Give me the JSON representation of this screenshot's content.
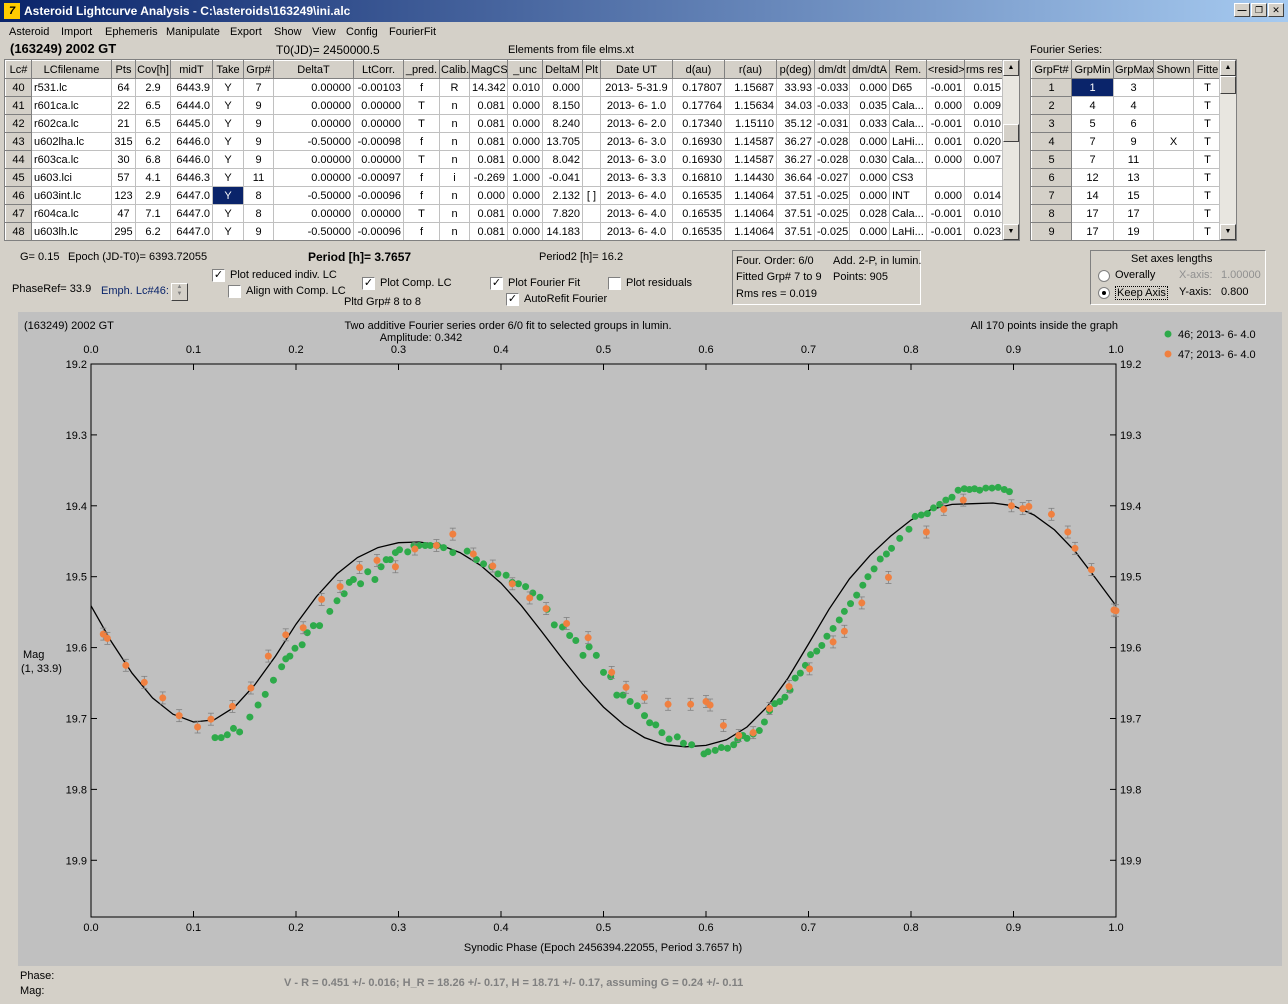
{
  "window": {
    "title": "Asteroid Lightcurve Analysis - C:\\asteroids\\163249\\ini.alc",
    "icon_label": "7"
  },
  "menu": [
    "Asteroid",
    "Import",
    "Ephemeris",
    "Manipulate",
    "Export",
    "Show",
    "View",
    "Config",
    "FourierFit"
  ],
  "asteroid_name": "(163249) 2002 GT",
  "t0": "T0(JD)= 2450000.5",
  "elements_note": "Elements from file elms.xt",
  "fourier_series_label": "Fourier Series:",
  "lc_table": {
    "headers": [
      "Lc#",
      "LCfilename",
      "Pts",
      "Cov[h]",
      "midT",
      "Take",
      "Grp#",
      "DeltaT",
      "LtCorr.",
      "_pred.",
      "Calib.",
      "MagCS",
      "_unc",
      "DeltaM",
      "Plt",
      "Date UT",
      "d(au)",
      "r(au)",
      "p(deg)",
      "dm/dt",
      "dm/dtA",
      "Rem.",
      "<resid>",
      "rms res"
    ],
    "rows": [
      [
        "40",
        "r531.lc",
        "64",
        "2.9",
        "6443.9",
        "Y",
        "7",
        "0.00000",
        "-0.00103",
        "f",
        "R",
        "14.342",
        "0.010",
        "0.000",
        "",
        "2013- 5-31.9",
        "0.17807",
        "1.15687",
        "33.93",
        "-0.033",
        "0.000",
        "D65",
        "-0.001",
        "0.015"
      ],
      [
        "41",
        "r601ca.lc",
        "22",
        "6.5",
        "6444.0",
        "Y",
        "9",
        "0.00000",
        "0.00000",
        "T",
        "n",
        "0.081",
        "0.000",
        "8.150",
        "",
        "2013- 6- 1.0",
        "0.17764",
        "1.15634",
        "34.03",
        "-0.033",
        "0.035",
        "Cala...",
        "0.000",
        "0.009"
      ],
      [
        "42",
        "r602ca.lc",
        "21",
        "6.5",
        "6445.0",
        "Y",
        "9",
        "0.00000",
        "0.00000",
        "T",
        "n",
        "0.081",
        "0.000",
        "8.240",
        "",
        "2013- 6- 2.0",
        "0.17340",
        "1.15110",
        "35.12",
        "-0.031",
        "0.033",
        "Cala...",
        "-0.001",
        "0.010"
      ],
      [
        "43",
        "u602lha.lc",
        "315",
        "6.2",
        "6446.0",
        "Y",
        "9",
        "-0.50000",
        "-0.00098",
        "f",
        "n",
        "0.081",
        "0.000",
        "13.705",
        "",
        "2013- 6- 3.0",
        "0.16930",
        "1.14587",
        "36.27",
        "-0.028",
        "0.000",
        "LaHi...",
        "0.001",
        "0.020"
      ],
      [
        "44",
        "r603ca.lc",
        "30",
        "6.8",
        "6446.0",
        "Y",
        "9",
        "0.00000",
        "0.00000",
        "T",
        "n",
        "0.081",
        "0.000",
        "8.042",
        "",
        "2013- 6- 3.0",
        "0.16930",
        "1.14587",
        "36.27",
        "-0.028",
        "0.030",
        "Cala...",
        "0.000",
        "0.007"
      ],
      [
        "45",
        "u603.lci",
        "57",
        "4.1",
        "6446.3",
        "Y",
        "11",
        "0.00000",
        "-0.00097",
        "f",
        "i",
        "-0.269",
        "1.000",
        "-0.041",
        "",
        "2013- 6- 3.3",
        "0.16810",
        "1.14430",
        "36.64",
        "-0.027",
        "0.000",
        "CS3",
        "",
        ""
      ],
      [
        "46",
        "u603int.lc",
        "123",
        "2.9",
        "6447.0",
        "Y",
        "8",
        "-0.50000",
        "-0.00096",
        "f",
        "n",
        "0.000",
        "0.000",
        "2.132",
        "[ ]",
        "2013- 6- 4.0",
        "0.16535",
        "1.14064",
        "37.51",
        "-0.025",
        "0.000",
        "INT",
        "0.000",
        "0.014"
      ],
      [
        "47",
        "r604ca.lc",
        "47",
        "7.1",
        "6447.0",
        "Y",
        "8",
        "0.00000",
        "0.00000",
        "T",
        "n",
        "0.081",
        "0.000",
        "7.820",
        "",
        "2013- 6- 4.0",
        "0.16535",
        "1.14064",
        "37.51",
        "-0.025",
        "0.028",
        "Cala...",
        "-0.001",
        "0.010"
      ],
      [
        "48",
        "u603lh.lc",
        "295",
        "6.2",
        "6447.0",
        "Y",
        "9",
        "-0.50000",
        "-0.00096",
        "f",
        "n",
        "0.081",
        "0.000",
        "14.183",
        "",
        "2013- 6- 4.0",
        "0.16535",
        "1.14064",
        "37.51",
        "-0.025",
        "0.000",
        "LaHi...",
        "-0.001",
        "0.023"
      ]
    ]
  },
  "fourier_table": {
    "headers": [
      "GrpFt#",
      "GrpMin",
      "GrpMax",
      "Shown",
      "Fitte"
    ],
    "rows": [
      [
        "1",
        "1",
        "3",
        "",
        "T"
      ],
      [
        "2",
        "4",
        "4",
        "",
        "T"
      ],
      [
        "3",
        "5",
        "6",
        "",
        "T"
      ],
      [
        "4",
        "7",
        "9",
        "X",
        "T"
      ],
      [
        "5",
        "7",
        "11",
        "",
        "T"
      ],
      [
        "6",
        "12",
        "13",
        "",
        "T"
      ],
      [
        "7",
        "14",
        "15",
        "",
        "T"
      ],
      [
        "8",
        "17",
        "17",
        "",
        "T"
      ],
      [
        "9",
        "17",
        "19",
        "",
        "T"
      ]
    ]
  },
  "controls": {
    "g": "G= 0.15",
    "epoch": "Epoch (JD-T0)= 6393.72055",
    "period": "Period [h]= 3.7657",
    "period2": "Period2 [h]= 16.2",
    "phaseref": "PhaseRef= 33.9",
    "emph": "Emph. Lc#46:",
    "plot_reduced": "Plot reduced indiv. LC",
    "align_comp": "Align with Comp. LC",
    "plot_comp": "Plot Comp. LC",
    "pltd_grp": "Pltd Grp#  8  to  8",
    "plot_fourier": "Plot Fourier Fit",
    "autorefit": "AutoRefit Fourier",
    "plot_residuals": "Plot residuals",
    "check": "✓"
  },
  "fit_info": {
    "four_order": "Four. Order:  6/0",
    "add": "Add. 2-P, in lumin.",
    "fitted": "Fitted Grp# 7 to 9",
    "points": "Points: 905",
    "rms": "Rms res     = 0.019"
  },
  "axes_box": {
    "title": "Set axes lengths",
    "overall": "Overally",
    "keep": "Keep Axis",
    "xaxis_label": "X-axis:",
    "xaxis_val": "1.00000",
    "yaxis_label": "Y-axis:",
    "yaxis_val": "0.800"
  },
  "footer": {
    "phase": "Phase:",
    "mag": "Mag:",
    "result": "V - R = 0.451 +/- 0.016; H_R = 18.26 +/- 0.17, H = 18.71 +/- 0.17, assuming G = 0.24 +/- 0.11"
  },
  "chart_data": {
    "type": "scatter",
    "corner_label": "(163249) 2002 GT",
    "title": "Two additive Fourier series order 6/0 fit to selected groups in lumin.",
    "subtitle": "Amplitude: 0.342",
    "note": "All 170 points inside the graph",
    "xlabel": "Synodic Phase (Epoch 2456394.22055, Period 3.7657 h)",
    "ylabel": "Mag",
    "ylabel2": "(1, 33.9)",
    "xlim": [
      0,
      1
    ],
    "ylim": [
      19.2,
      19.98
    ],
    "y_inverted": true,
    "xticks": [
      "0.0",
      "0.1",
      "0.2",
      "0.3",
      "0.4",
      "0.5",
      "0.6",
      "0.7",
      "0.8",
      "0.9",
      "1.0"
    ],
    "yticks": [
      "19.2",
      "19.3",
      "19.4",
      "19.5",
      "19.6",
      "19.7",
      "19.8",
      "19.9"
    ],
    "legend": "top-right",
    "fit_curve": {
      "color": "#000000",
      "x": [
        0.0,
        0.02,
        0.04,
        0.06,
        0.08,
        0.1,
        0.12,
        0.14,
        0.16,
        0.18,
        0.2,
        0.22,
        0.24,
        0.26,
        0.28,
        0.3,
        0.32,
        0.34,
        0.36,
        0.38,
        0.4,
        0.42,
        0.44,
        0.46,
        0.48,
        0.5,
        0.52,
        0.54,
        0.56,
        0.58,
        0.6,
        0.62,
        0.64,
        0.66,
        0.68,
        0.7,
        0.72,
        0.74,
        0.76,
        0.78,
        0.8,
        0.82,
        0.84,
        0.86,
        0.88,
        0.9,
        0.92,
        0.94,
        0.96,
        0.98,
        1.0
      ],
      "y": [
        19.541,
        19.592,
        19.636,
        19.671,
        19.694,
        19.705,
        19.702,
        19.684,
        19.652,
        19.612,
        19.567,
        19.528,
        19.496,
        19.473,
        19.459,
        19.452,
        19.451,
        19.455,
        19.466,
        19.484,
        19.509,
        19.541,
        19.578,
        19.616,
        19.652,
        19.684,
        19.709,
        19.727,
        19.737,
        19.74,
        19.738,
        19.73,
        19.712,
        19.683,
        19.643,
        19.595,
        19.546,
        19.503,
        19.47,
        19.443,
        19.42,
        19.405,
        19.398,
        19.397,
        19.396,
        19.4,
        19.413,
        19.434,
        19.464,
        19.502,
        19.541
      ]
    },
    "series": [
      {
        "name": "46; 2013- 6- 4.0",
        "color": "#2eaa4a",
        "x": [
          0.121,
          0.127,
          0.133,
          0.139,
          0.145,
          0.155,
          0.163,
          0.17,
          0.178,
          0.186,
          0.19,
          0.194,
          0.199,
          0.206,
          0.211,
          0.217,
          0.223,
          0.233,
          0.24,
          0.247,
          0.252,
          0.256,
          0.263,
          0.27,
          0.277,
          0.283,
          0.288,
          0.292,
          0.297,
          0.301,
          0.309,
          0.315,
          0.32,
          0.326,
          0.331,
          0.338,
          0.344,
          0.353,
          0.367,
          0.376,
          0.383,
          0.391,
          0.397,
          0.405,
          0.411,
          0.417,
          0.424,
          0.431,
          0.438,
          0.445,
          0.452,
          0.46,
          0.467,
          0.473,
          0.48,
          0.486,
          0.493,
          0.5,
          0.507,
          0.513,
          0.519,
          0.526,
          0.533,
          0.54,
          0.545,
          0.551,
          0.557,
          0.564,
          0.572,
          0.578,
          0.586,
          0.598,
          0.602,
          0.609,
          0.615,
          0.621,
          0.627,
          0.631,
          0.636,
          0.64,
          0.646,
          0.652,
          0.657,
          0.662,
          0.667,
          0.672,
          0.677,
          0.682,
          0.687,
          0.692,
          0.697,
          0.702,
          0.708,
          0.713,
          0.718,
          0.724,
          0.73,
          0.735,
          0.741,
          0.747,
          0.753,
          0.758,
          0.764,
          0.77,
          0.776,
          0.781,
          0.789,
          0.798,
          0.804,
          0.81,
          0.816,
          0.822,
          0.828,
          0.834,
          0.84,
          0.846,
          0.852,
          0.857,
          0.862,
          0.867,
          0.873,
          0.879,
          0.885,
          0.891,
          0.896
        ],
        "y": [
          19.727,
          19.727,
          19.723,
          19.714,
          19.719,
          19.698,
          19.681,
          19.666,
          19.646,
          19.627,
          19.616,
          19.612,
          19.601,
          19.596,
          19.579,
          19.569,
          19.569,
          19.549,
          19.534,
          19.524,
          19.508,
          19.504,
          19.51,
          19.493,
          19.504,
          19.486,
          19.476,
          19.476,
          19.466,
          19.462,
          19.465,
          19.456,
          19.456,
          19.456,
          19.456,
          19.456,
          19.459,
          19.466,
          19.464,
          19.476,
          19.482,
          19.486,
          19.496,
          19.498,
          19.508,
          19.51,
          19.514,
          19.523,
          19.529,
          19.546,
          19.568,
          19.571,
          19.583,
          19.59,
          19.611,
          19.599,
          19.611,
          19.635,
          19.641,
          19.667,
          19.667,
          19.676,
          19.682,
          19.696,
          19.706,
          19.709,
          19.72,
          19.729,
          19.726,
          19.735,
          19.737,
          19.75,
          19.747,
          19.745,
          19.741,
          19.742,
          19.737,
          19.73,
          19.724,
          19.728,
          19.722,
          19.717,
          19.705,
          19.689,
          19.679,
          19.676,
          19.67,
          19.66,
          19.643,
          19.636,
          19.625,
          19.61,
          19.605,
          19.597,
          19.584,
          19.573,
          19.561,
          19.549,
          19.538,
          19.526,
          19.512,
          19.5,
          19.489,
          19.475,
          19.468,
          19.46,
          19.446,
          19.433,
          19.415,
          19.413,
          19.411,
          19.403,
          19.398,
          19.392,
          19.388,
          19.378,
          19.376,
          19.377,
          19.376,
          19.378,
          19.375,
          19.375,
          19.374,
          19.377,
          19.38
        ]
      },
      {
        "name": "47; 2013- 6- 4.0",
        "color": "#f08040",
        "x": [
          0.012,
          0.016,
          0.034,
          0.052,
          0.07,
          0.086,
          0.104,
          0.117,
          0.138,
          0.156,
          0.173,
          0.19,
          0.207,
          0.225,
          0.243,
          0.262,
          0.279,
          0.297,
          0.316,
          0.337,
          0.353,
          0.373,
          0.392,
          0.411,
          0.428,
          0.444,
          0.464,
          0.485,
          0.508,
          0.522,
          0.54,
          0.563,
          0.585,
          0.6,
          0.604,
          0.617,
          0.632,
          0.646,
          0.662,
          0.681,
          0.701,
          0.724,
          0.735,
          0.752,
          0.778,
          0.815,
          0.832,
          0.851,
          0.898,
          0.909,
          0.915,
          0.937,
          0.953,
          0.96,
          0.976,
          0.998,
          1.0
        ],
        "y": [
          19.581,
          19.587,
          19.625,
          19.649,
          19.671,
          19.696,
          19.712,
          19.701,
          19.683,
          19.657,
          19.612,
          19.582,
          19.572,
          19.532,
          19.514,
          19.487,
          19.477,
          19.486,
          19.461,
          19.456,
          19.44,
          19.468,
          19.485,
          19.51,
          19.53,
          19.545,
          19.566,
          19.586,
          19.635,
          19.656,
          19.67,
          19.68,
          19.68,
          19.676,
          19.681,
          19.71,
          19.724,
          19.72,
          19.686,
          19.655,
          19.63,
          19.592,
          19.577,
          19.537,
          19.501,
          19.437,
          19.405,
          19.392,
          19.4,
          19.404,
          19.401,
          19.412,
          19.437,
          19.46,
          19.49,
          19.547,
          19.548
        ]
      }
    ]
  }
}
